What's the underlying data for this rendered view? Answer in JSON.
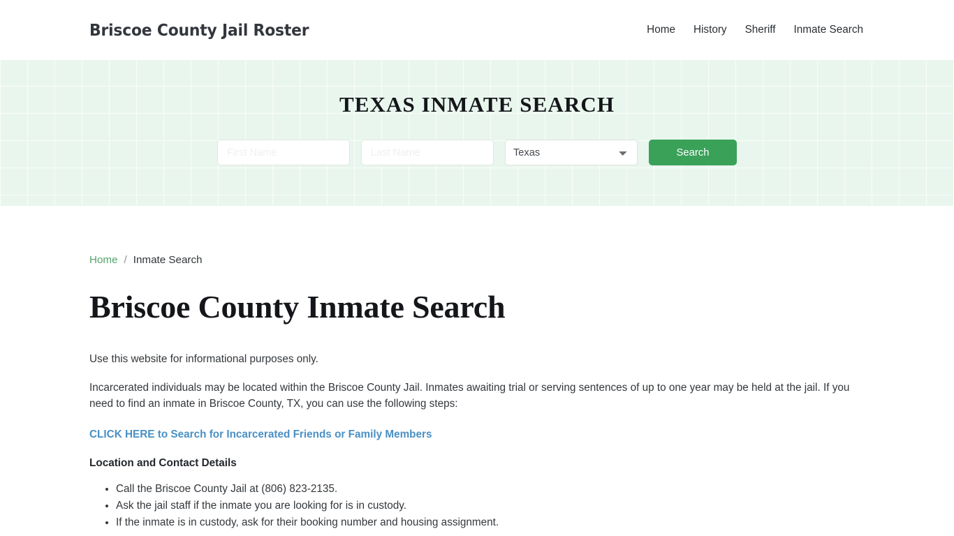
{
  "header": {
    "brand": "Briscoe County Jail Roster",
    "nav": [
      {
        "label": "Home"
      },
      {
        "label": "History"
      },
      {
        "label": "Sheriff"
      },
      {
        "label": "Inmate Search"
      }
    ]
  },
  "hero": {
    "title": "TEXAS INMATE SEARCH",
    "form": {
      "first_name_placeholder": "First Name",
      "first_name_value": "",
      "last_name_placeholder": "Last Name",
      "last_name_value": "",
      "state_selected": "Texas",
      "search_label": "Search"
    },
    "accent_color": "#3aa159",
    "background_color": "#e9f6ee"
  },
  "breadcrumb": {
    "home": "Home",
    "separator": "/",
    "current": "Inmate Search"
  },
  "main": {
    "title": "Briscoe County Inmate Search",
    "intro": "Use this website for informational purposes only.",
    "paragraph": "Incarcerated individuals may be located within the Briscoe County Jail. Inmates awaiting trial or serving sentences of up to one year may be held at the jail. If you need to find an inmate in Briscoe County, TX, you can use the following steps:",
    "cta_link": "CLICK HERE to Search for Incarcerated Friends or Family Members",
    "cta_color": "#4a90c4",
    "section_heading": "Location and Contact Details",
    "steps": [
      "Call the Briscoe County Jail at (806) 823-2135.",
      "Ask the jail staff if the inmate you are looking for is in custody.",
      "If the inmate is in custody, ask for their booking number and housing assignment."
    ]
  }
}
